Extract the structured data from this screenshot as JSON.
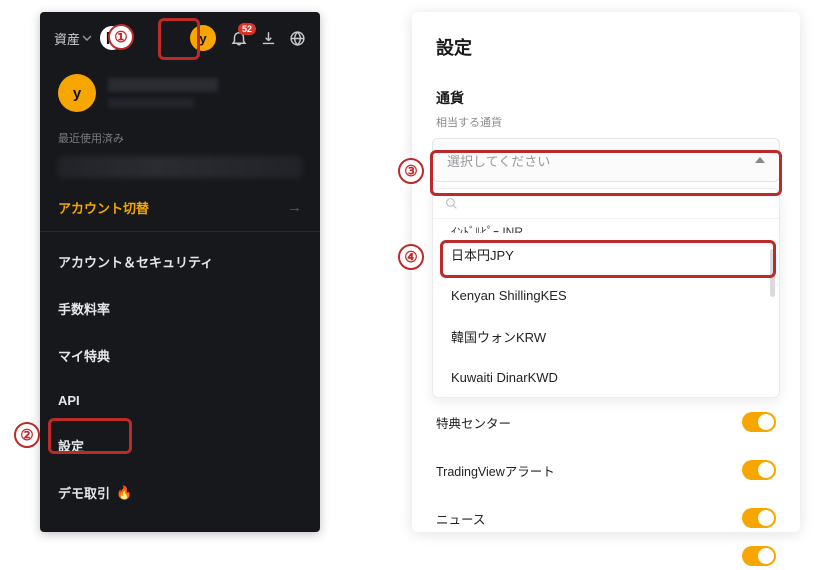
{
  "left": {
    "assets_label": "資産",
    "avatar_letter": "y",
    "badge_count": "52",
    "recent_label": "最近使用済み",
    "switch_label": "アカウント切替",
    "menu": [
      "アカウント＆セキュリティ",
      "手数料率",
      "マイ特典",
      "API",
      "設定",
      "デモ取引"
    ]
  },
  "right": {
    "title": "設定",
    "currency_heading": "通貨",
    "currency_helper": "相当する通貨",
    "select_placeholder": "選択してください",
    "dropdown": {
      "clipped_top": "ｲﾝﾄﾞﾙﾋﾟｰ INR",
      "items": [
        "日本円JPY",
        "Kenyan ShillingKES",
        "韓国ウォンKRW",
        "Kuwaiti DinarKWD"
      ]
    },
    "toggles": [
      "特典センター",
      "TradingViewアラート",
      "ニュース"
    ]
  },
  "markers": {
    "one": "①",
    "two": "②",
    "three": "③",
    "four": "④"
  }
}
